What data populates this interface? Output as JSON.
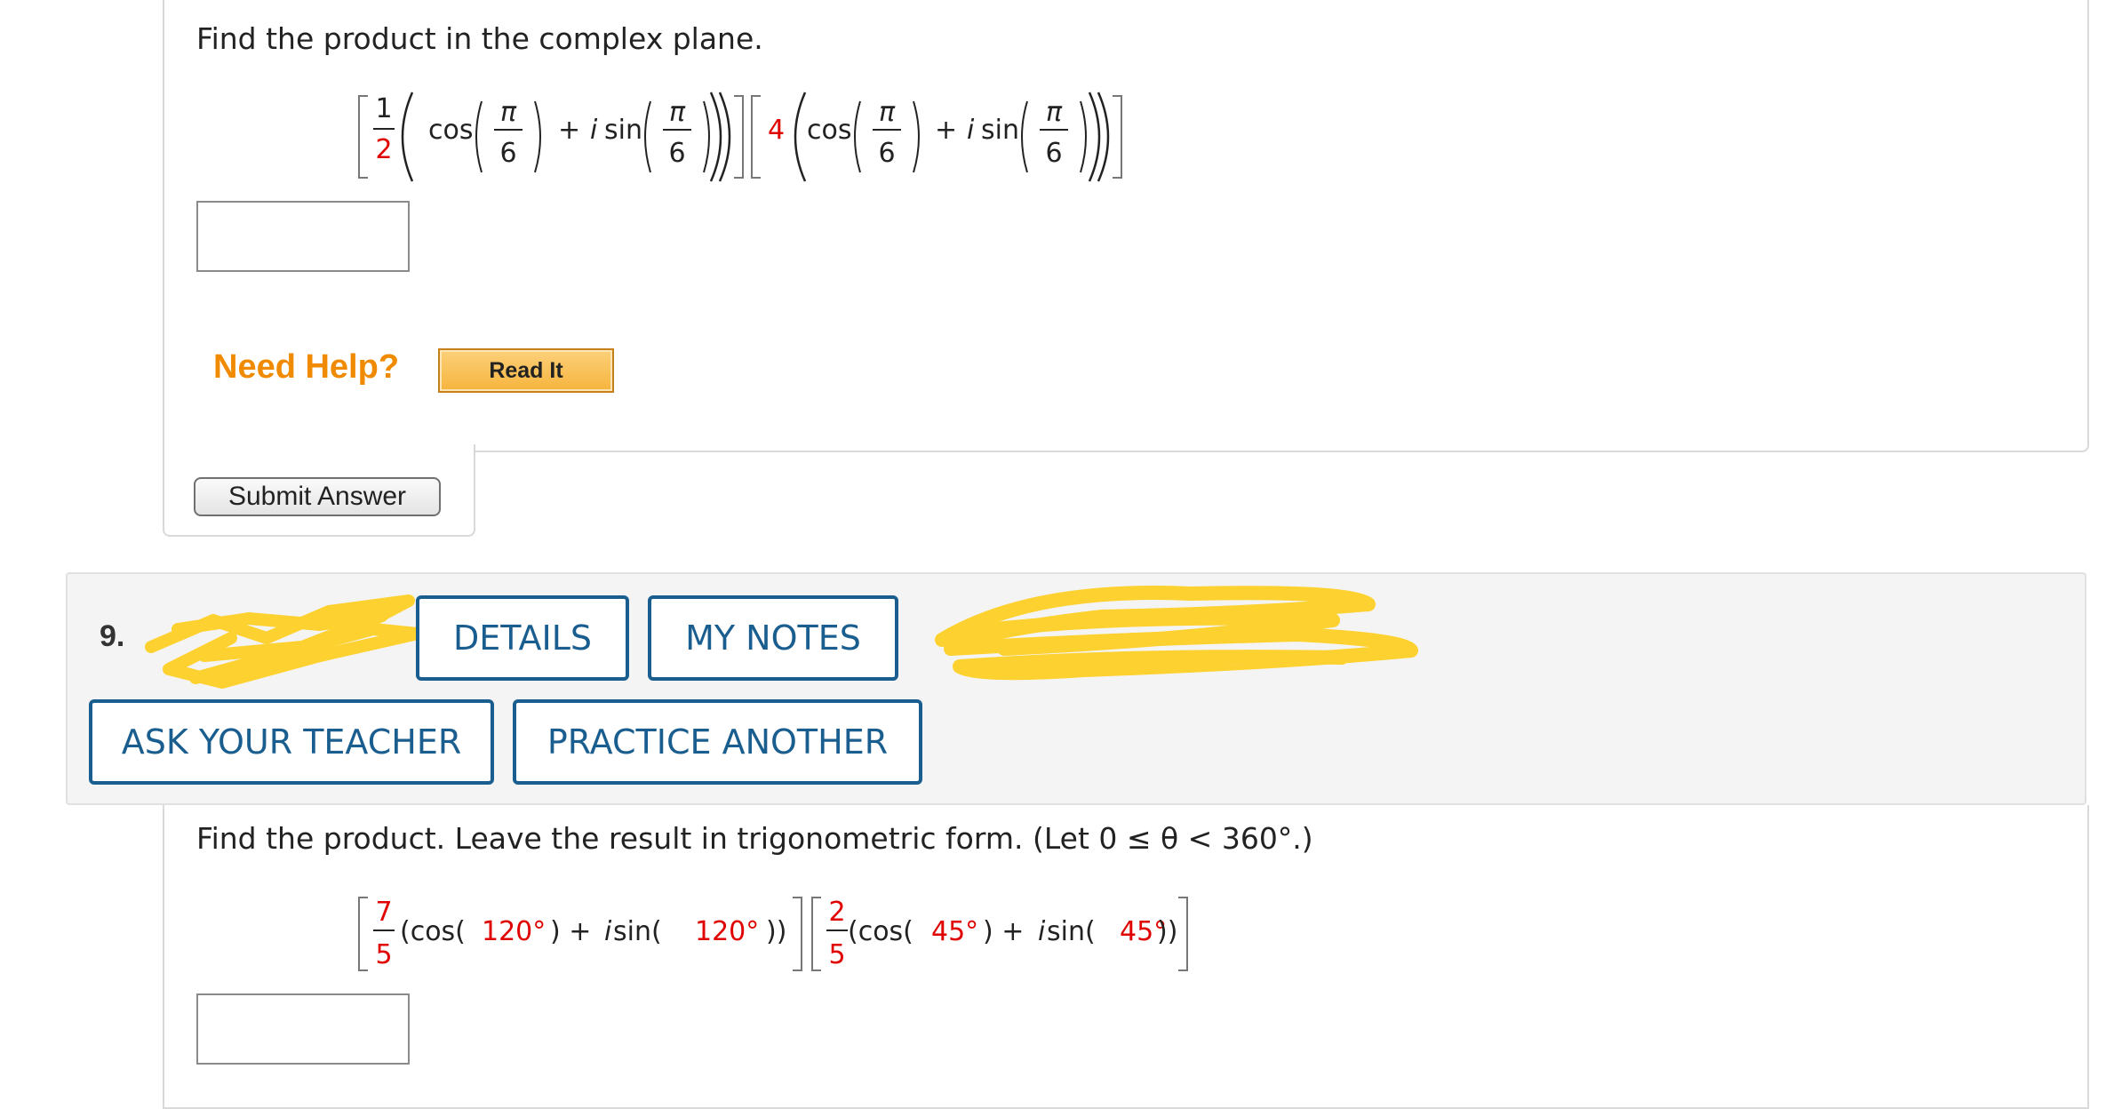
{
  "q8": {
    "prompt": "Find the product in the complex plane.",
    "expr": {
      "f1_num": "1",
      "f1_den": "2",
      "coeff2": "4",
      "cos": "cos",
      "plus_i_sin": "+ i sin",
      "i": "i",
      "sin": "sin",
      "plus": "+",
      "pi": "π",
      "six": "6"
    },
    "answer_value": "",
    "need_help": "Need Help?",
    "read_it": "Read It",
    "submit": "Submit Answer"
  },
  "q9": {
    "number": "9.",
    "buttons": {
      "details": "DETAILS",
      "my_notes": "MY NOTES",
      "ask_teacher": "ASK YOUR TEACHER",
      "practice": "PRACTICE ANOTHER"
    },
    "prompt": "Find the product. Leave the result in trigonometric form. (Let 0 ≤ θ < 360°.)",
    "expr": {
      "f1_num": "7",
      "f1_den": "5",
      "f2_num": "2",
      "f2_den": "5",
      "a1": "120°",
      "a2": "45°",
      "open_cos": "(cos(",
      "close_plus": ") + ",
      "i": "i",
      "sin_open": " sin(",
      "close2": "))"
    },
    "answer_value": ""
  },
  "colors": {
    "accent_blue": "#1a5e8f",
    "highlight_red": "#e00000",
    "help_orange": "#f08a00",
    "scribble_yellow": "#fdd12f"
  },
  "icons": [
    "redaction-scribble"
  ]
}
